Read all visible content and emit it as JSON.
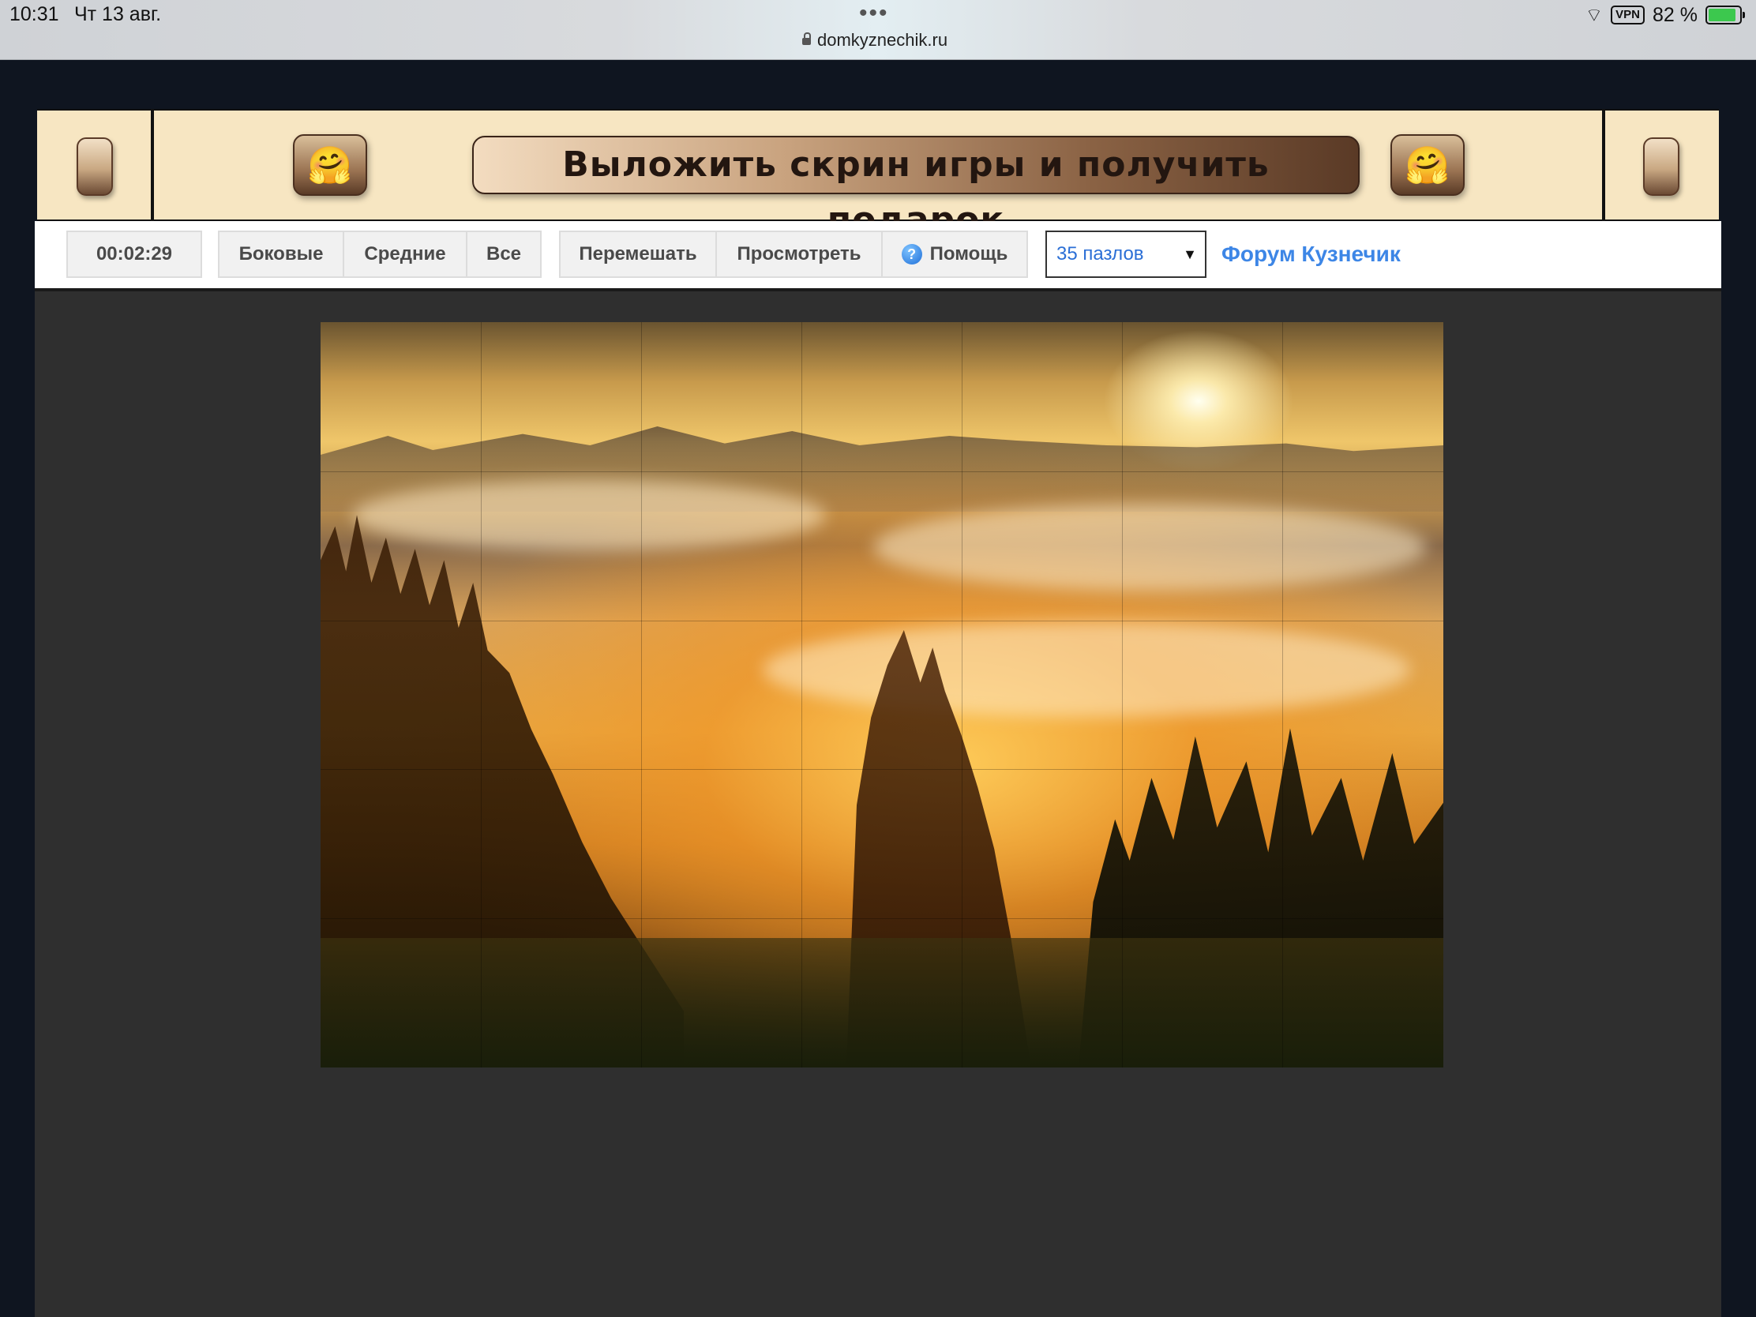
{
  "statusbar": {
    "time": "10:31",
    "date": "Чт 13 авг.",
    "url": "domkyznechik.ru",
    "vpn": "VPN",
    "battery": "82 %"
  },
  "banner": {
    "title": "Выложить скрин игры и получить подарок",
    "emoji": "🤗"
  },
  "toolbar": {
    "timer": "00:02:29",
    "filters": [
      "Боковые",
      "Средние",
      "Все"
    ],
    "actions": [
      "Перемешать",
      "Просмотреть"
    ],
    "help_label": "Помощь",
    "help_icon": "?",
    "pieces_select": "35 пазлов",
    "forum_link": "Форум Кузнечик"
  },
  "puzzle": {
    "image": "sunrise-forest-puzzle",
    "columns": 7,
    "rows": 5
  },
  "colors": {
    "banner_bg": "#f7e6c2",
    "link": "#3d86e6",
    "play_bg": "#2f2f2f",
    "page_bg": "#0f1520"
  }
}
